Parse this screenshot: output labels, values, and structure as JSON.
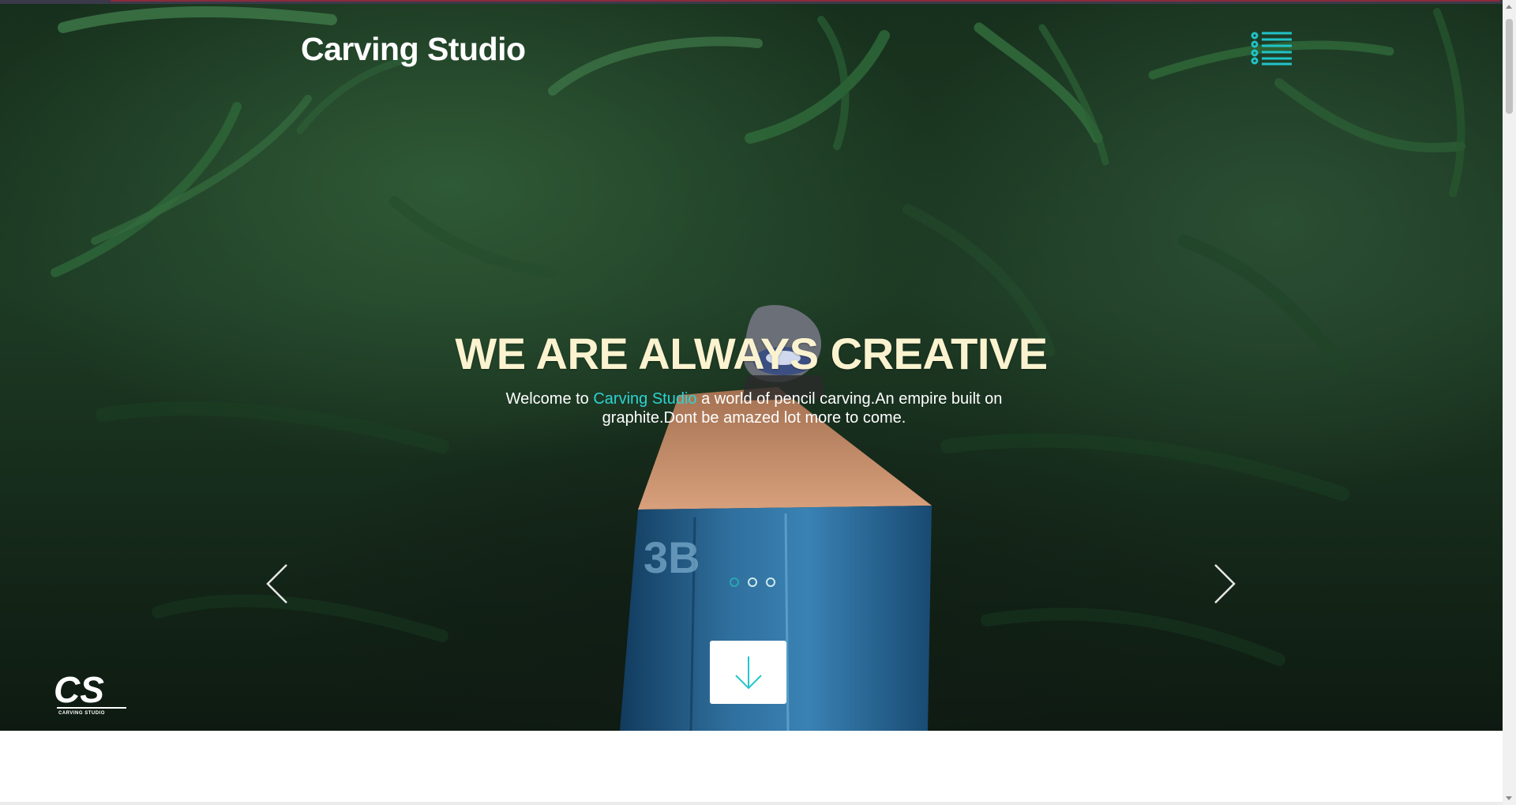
{
  "header": {
    "brand": "Carving Studio",
    "menu_icon": "list-menu-icon"
  },
  "hero": {
    "headline": "WE ARE ALWAYS CREATIVE",
    "sub_prefix": "Welcome to ",
    "sub_brand": "Carving Studio",
    "sub_suffix": " a world of pencil carving.An empire built on graphite.Dont be amazed lot more to come.",
    "slides": 3,
    "active_slide": 1,
    "prev_icon": "chevron-left-icon",
    "next_icon": "chevron-right-icon",
    "scroll_icon": "arrow-down-icon"
  },
  "footer_logo": {
    "text": "CS",
    "caption": "CARVING STUDIO"
  },
  "colors": {
    "accent": "#2ed3d3",
    "headline": "#fbf3cf",
    "white": "#ffffff"
  }
}
